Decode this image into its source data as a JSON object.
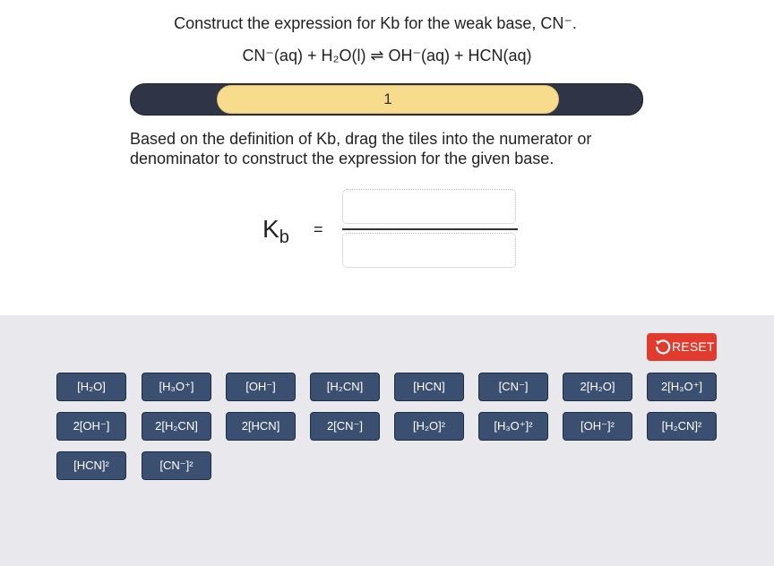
{
  "question": {
    "title": "Construct the expression for Kb for the weak base, CN⁻.",
    "equation": "CN⁻(aq) + H₂O(l) ⇌ OH⁻(aq) + HCN(aq)"
  },
  "progress": {
    "step_label": "1"
  },
  "instructions": "Based on the definition of Kb, drag the tiles into the numerator or denominator to construct the expression for the given base.",
  "expression": {
    "k_symbol": "K",
    "k_subscript": "b",
    "equals": "="
  },
  "tray": {
    "reset_label": "RESET",
    "reset_color": "#e03b2c",
    "tile_color": "#3b5070",
    "tiles": [
      "[H₂O]",
      "[H₃O⁺]",
      "[OH⁻]",
      "[H₂CN]",
      "[HCN]",
      "[CN⁻]",
      "2[H₂O]",
      "2[H₃O⁺]",
      "2[OH⁻]",
      "2[H₂CN]",
      "2[HCN]",
      "2[CN⁻]",
      "[H₂O]²",
      "[H₃O⁺]²",
      "[OH⁻]²",
      "[H₂CN]²",
      "[HCN]²",
      "[CN⁻]²"
    ]
  }
}
